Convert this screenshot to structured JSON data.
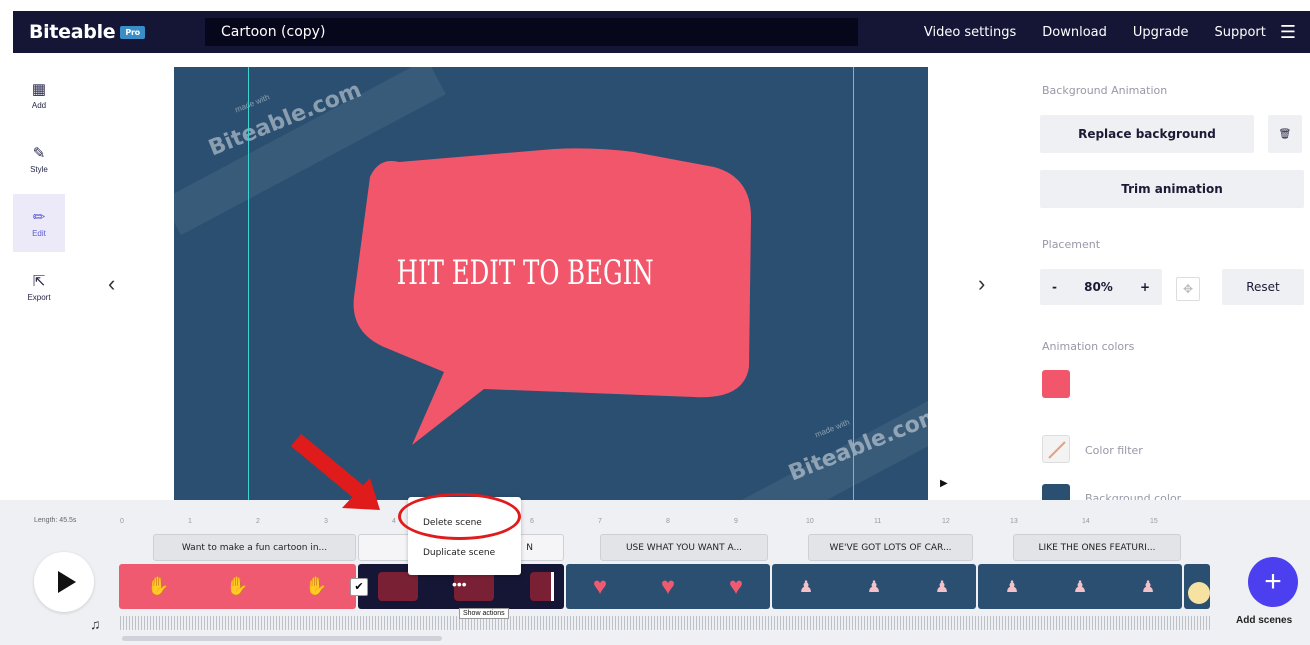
{
  "header": {
    "logo": "Biteable",
    "badge": "Pro",
    "project_title": "Cartoon (copy)",
    "nav": [
      "Video settings",
      "Download",
      "Upgrade",
      "Support"
    ]
  },
  "sidebar": {
    "items": [
      {
        "label": "Add",
        "icon": "grid-icon"
      },
      {
        "label": "Style",
        "icon": "brush-icon"
      },
      {
        "label": "Edit",
        "icon": "pencil-icon"
      },
      {
        "label": "Export",
        "icon": "export-icon"
      }
    ]
  },
  "canvas": {
    "headline": "HIT EDIT TO BEGIN",
    "watermark": "Biteable.com",
    "watermark_small": "made with"
  },
  "panel": {
    "background_animation_label": "Background Animation",
    "replace_background": "Replace background",
    "trim_animation": "Trim animation",
    "placement_label": "Placement",
    "zoom_value": "80%",
    "reset": "Reset",
    "animation_colors_label": "Animation colors",
    "color_filter": "Color filter",
    "background_color": "Background color",
    "colors": {
      "animation": "#f2566b",
      "background": "#2a4f70"
    }
  },
  "timeline": {
    "length_label": "Length: 45.5s",
    "ticks": [
      "0",
      "1",
      "2",
      "3",
      "4",
      "5",
      "6",
      "7",
      "8",
      "9",
      "10",
      "11",
      "12",
      "13",
      "14",
      "15"
    ],
    "scenes": [
      {
        "label": "Want to make a fun cartoon in..."
      },
      {
        "label": "N"
      },
      {
        "label": "USE WHAT YOU WANT A..."
      },
      {
        "label": "WE'VE GOT LOTS OF CAR..."
      },
      {
        "label": "LIKE THE ONES FEATURI..."
      }
    ],
    "add_scenes": "Add scenes"
  },
  "context_menu": {
    "items": [
      "Delete scene",
      "Duplicate scene"
    ],
    "tooltip": "Show actions"
  }
}
